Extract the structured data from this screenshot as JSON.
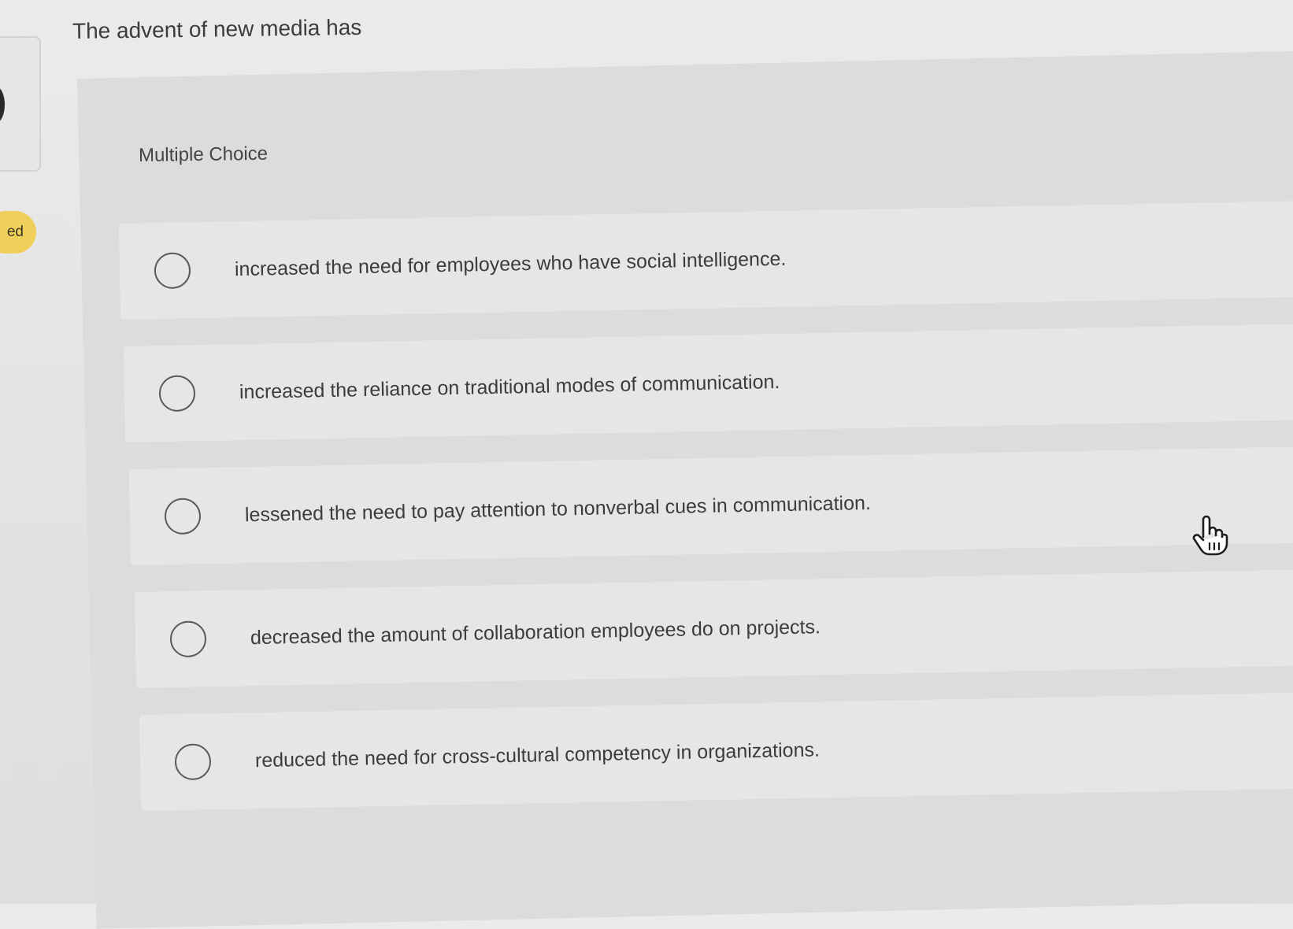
{
  "sidebar": {
    "badge_text": "ed"
  },
  "question": {
    "text": "The advent of new media has"
  },
  "question_type": {
    "label": "Multiple Choice"
  },
  "options": [
    {
      "label": "increased the need for employees who have social intelligence.",
      "selected": false
    },
    {
      "label": "increased the reliance on traditional modes of communication.",
      "selected": false
    },
    {
      "label": "lessened the need to pay attention to nonverbal cues in communication.",
      "selected": false
    },
    {
      "label": "decreased the amount of collaboration employees do on projects.",
      "selected": false
    },
    {
      "label": "reduced the need for cross-cultural competency in organizations.",
      "selected": false
    }
  ],
  "cursor": {
    "icon": "hand-pointer-icon"
  }
}
